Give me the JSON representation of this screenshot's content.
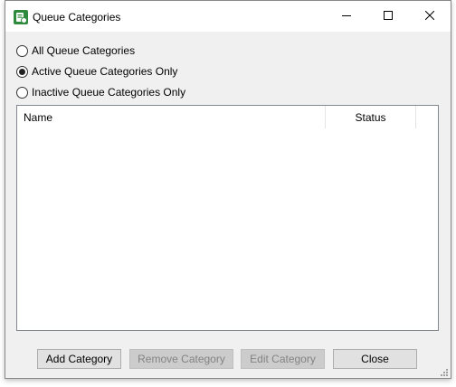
{
  "window": {
    "title": "Queue Categories",
    "icon": "app-icon",
    "controls": [
      "minimize-icon",
      "maximize-icon",
      "close-icon"
    ]
  },
  "filter": {
    "options": [
      {
        "label": "All Queue Categories",
        "checked": false
      },
      {
        "label": "Active Queue Categories Only",
        "checked": true
      },
      {
        "label": "Inactive Queue Categories Only",
        "checked": false
      }
    ]
  },
  "list": {
    "columns": [
      "Name",
      "Status"
    ],
    "rows": []
  },
  "buttons": {
    "add": {
      "label": "Add Category",
      "enabled": true
    },
    "remove": {
      "label": "Remove Category",
      "enabled": false
    },
    "edit": {
      "label": "Edit Category",
      "enabled": false
    },
    "close": {
      "label": "Close",
      "enabled": true
    }
  },
  "colors": {
    "accent": "#2e8b3e",
    "window_bg": "#f0f0f0",
    "button_bg": "#e1e1e1",
    "disabled_text": "#838383"
  }
}
